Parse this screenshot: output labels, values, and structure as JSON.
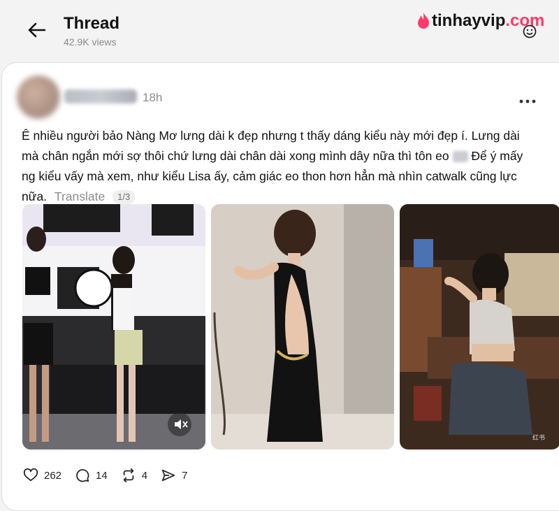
{
  "header": {
    "title": "Thread",
    "views": "42.9K views"
  },
  "logo": {
    "brand": "tinhayvip",
    "tld": ".com"
  },
  "post": {
    "time": "18h",
    "text_1": "Ê nhiều người bảo Nàng Mơ lưng dài k đẹp nhưng t thấy dáng kiểu này mới đẹp í. Lưng dài mà chân ngắn mới sợ thôi chứ lưng dài chân dài xong mình dây nữa thì tôn eo",
    "text_2": " Để ý mấy ng kiểu vấy mà xem, như kiểu Lisa ấy, cảm giác eo thon hơn hẳn mà nhìn catwalk cũng lực nữa.",
    "translate_label": "Translate",
    "media_counter": "1/3",
    "watermark": "红书"
  },
  "actions": {
    "likes": "262",
    "replies": "14",
    "reposts": "4",
    "shares": "7"
  },
  "colors": {
    "brand_accent": "#ff3b6b",
    "muted_text": "#8d8d8d",
    "card_bg": "#ffffff",
    "page_bg": "#f3f3f3"
  },
  "icons": [
    "back-arrow-icon",
    "flame-icon",
    "smiley-face-icon",
    "more-icon",
    "mute-icon",
    "heart-icon",
    "comment-icon",
    "repost-icon",
    "share-icon"
  ]
}
